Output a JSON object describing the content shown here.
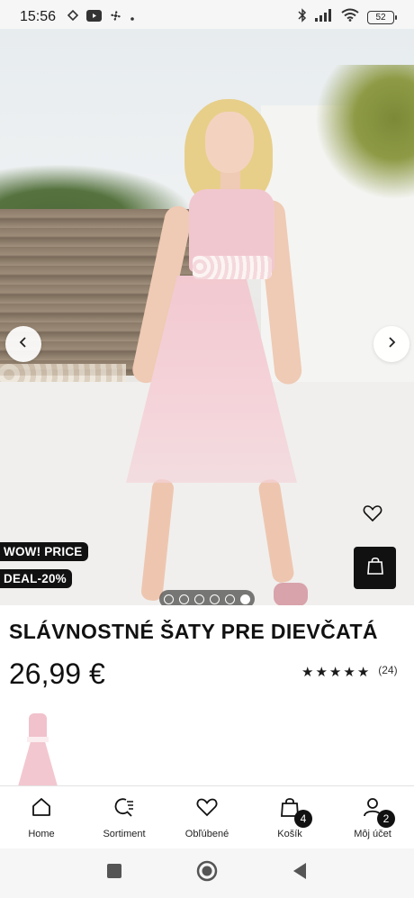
{
  "status_bar": {
    "time": "15:56",
    "battery": "52",
    "left_icons": [
      "google-pay-icon",
      "youtube-icon",
      "fan-icon",
      "dot-icon"
    ],
    "right_icons": [
      "bluetooth-icon",
      "signal-icon",
      "wifi-icon",
      "battery-icon"
    ]
  },
  "product": {
    "badges": {
      "wow": "WOW! PRICE",
      "deal": "DEAL-20%"
    },
    "title": "SLÁVNOSTNÉ ŠATY PRE DIEVČATÁ",
    "price": "26,99 €",
    "rating": {
      "stars": 5,
      "count": "(24)"
    },
    "gallery": {
      "total_images": 6,
      "active_index": 5
    }
  },
  "bottom_nav": [
    {
      "label": "Home",
      "icon": "home-icon"
    },
    {
      "label": "Sortiment",
      "icon": "search-list-icon"
    },
    {
      "label": "Obľúbené",
      "icon": "heart-icon"
    },
    {
      "label": "Košík",
      "icon": "bag-icon",
      "badge": "4"
    },
    {
      "label": "Môj účet",
      "icon": "user-icon",
      "badge": "2"
    }
  ],
  "colors": {
    "accent": "#111111",
    "dress": "#f1c7cf",
    "bar": "#f6f6f6"
  }
}
